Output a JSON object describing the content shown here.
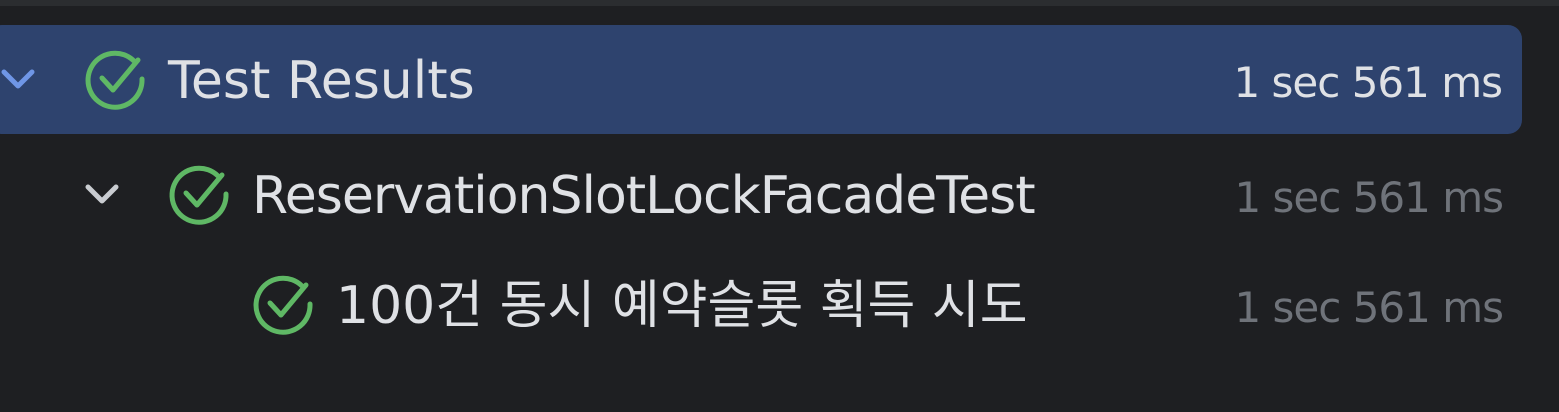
{
  "colors": {
    "background": "#1e1f22",
    "selection": "#2e436e",
    "pass_green": "#5fb865",
    "text": "#dfe1e5",
    "muted_text": "#6f737a"
  },
  "tree": [
    {
      "label": "Test Results",
      "duration": "1 sec 561 ms",
      "status_icon": "check-circle-icon",
      "expand_icon": "chevron-down-icon",
      "selected": true
    },
    {
      "label": "ReservationSlotLockFacadeTest",
      "duration": "1 sec 561 ms",
      "status_icon": "check-circle-icon",
      "expand_icon": "chevron-down-icon"
    },
    {
      "label": "100건 동시 예약슬롯 획득 시도",
      "duration": "1 sec 561 ms",
      "status_icon": "check-circle-icon"
    }
  ]
}
